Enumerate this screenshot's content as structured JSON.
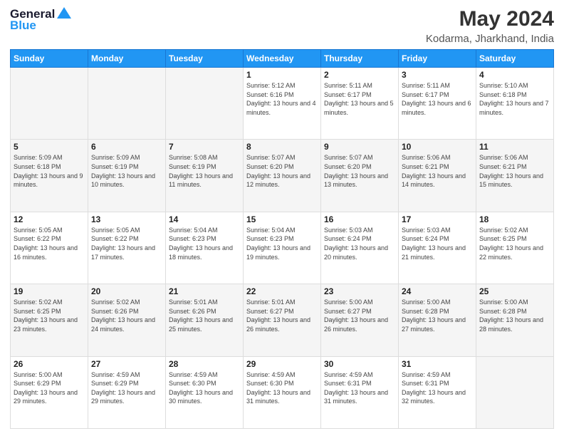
{
  "header": {
    "logo_general": "General",
    "logo_blue": "Blue",
    "title": "May 2024",
    "subtitle": "Kodarma, Jharkhand, India"
  },
  "weekdays": [
    "Sunday",
    "Monday",
    "Tuesday",
    "Wednesday",
    "Thursday",
    "Friday",
    "Saturday"
  ],
  "weeks": [
    [
      {
        "day": "",
        "sunrise": "",
        "sunset": "",
        "daylight": ""
      },
      {
        "day": "",
        "sunrise": "",
        "sunset": "",
        "daylight": ""
      },
      {
        "day": "",
        "sunrise": "",
        "sunset": "",
        "daylight": ""
      },
      {
        "day": "1",
        "sunrise": "Sunrise: 5:12 AM",
        "sunset": "Sunset: 6:16 PM",
        "daylight": "Daylight: 13 hours and 4 minutes."
      },
      {
        "day": "2",
        "sunrise": "Sunrise: 5:11 AM",
        "sunset": "Sunset: 6:17 PM",
        "daylight": "Daylight: 13 hours and 5 minutes."
      },
      {
        "day": "3",
        "sunrise": "Sunrise: 5:11 AM",
        "sunset": "Sunset: 6:17 PM",
        "daylight": "Daylight: 13 hours and 6 minutes."
      },
      {
        "day": "4",
        "sunrise": "Sunrise: 5:10 AM",
        "sunset": "Sunset: 6:18 PM",
        "daylight": "Daylight: 13 hours and 7 minutes."
      }
    ],
    [
      {
        "day": "5",
        "sunrise": "Sunrise: 5:09 AM",
        "sunset": "Sunset: 6:18 PM",
        "daylight": "Daylight: 13 hours and 9 minutes."
      },
      {
        "day": "6",
        "sunrise": "Sunrise: 5:09 AM",
        "sunset": "Sunset: 6:19 PM",
        "daylight": "Daylight: 13 hours and 10 minutes."
      },
      {
        "day": "7",
        "sunrise": "Sunrise: 5:08 AM",
        "sunset": "Sunset: 6:19 PM",
        "daylight": "Daylight: 13 hours and 11 minutes."
      },
      {
        "day": "8",
        "sunrise": "Sunrise: 5:07 AM",
        "sunset": "Sunset: 6:20 PM",
        "daylight": "Daylight: 13 hours and 12 minutes."
      },
      {
        "day": "9",
        "sunrise": "Sunrise: 5:07 AM",
        "sunset": "Sunset: 6:20 PM",
        "daylight": "Daylight: 13 hours and 13 minutes."
      },
      {
        "day": "10",
        "sunrise": "Sunrise: 5:06 AM",
        "sunset": "Sunset: 6:21 PM",
        "daylight": "Daylight: 13 hours and 14 minutes."
      },
      {
        "day": "11",
        "sunrise": "Sunrise: 5:06 AM",
        "sunset": "Sunset: 6:21 PM",
        "daylight": "Daylight: 13 hours and 15 minutes."
      }
    ],
    [
      {
        "day": "12",
        "sunrise": "Sunrise: 5:05 AM",
        "sunset": "Sunset: 6:22 PM",
        "daylight": "Daylight: 13 hours and 16 minutes."
      },
      {
        "day": "13",
        "sunrise": "Sunrise: 5:05 AM",
        "sunset": "Sunset: 6:22 PM",
        "daylight": "Daylight: 13 hours and 17 minutes."
      },
      {
        "day": "14",
        "sunrise": "Sunrise: 5:04 AM",
        "sunset": "Sunset: 6:23 PM",
        "daylight": "Daylight: 13 hours and 18 minutes."
      },
      {
        "day": "15",
        "sunrise": "Sunrise: 5:04 AM",
        "sunset": "Sunset: 6:23 PM",
        "daylight": "Daylight: 13 hours and 19 minutes."
      },
      {
        "day": "16",
        "sunrise": "Sunrise: 5:03 AM",
        "sunset": "Sunset: 6:24 PM",
        "daylight": "Daylight: 13 hours and 20 minutes."
      },
      {
        "day": "17",
        "sunrise": "Sunrise: 5:03 AM",
        "sunset": "Sunset: 6:24 PM",
        "daylight": "Daylight: 13 hours and 21 minutes."
      },
      {
        "day": "18",
        "sunrise": "Sunrise: 5:02 AM",
        "sunset": "Sunset: 6:25 PM",
        "daylight": "Daylight: 13 hours and 22 minutes."
      }
    ],
    [
      {
        "day": "19",
        "sunrise": "Sunrise: 5:02 AM",
        "sunset": "Sunset: 6:25 PM",
        "daylight": "Daylight: 13 hours and 23 minutes."
      },
      {
        "day": "20",
        "sunrise": "Sunrise: 5:02 AM",
        "sunset": "Sunset: 6:26 PM",
        "daylight": "Daylight: 13 hours and 24 minutes."
      },
      {
        "day": "21",
        "sunrise": "Sunrise: 5:01 AM",
        "sunset": "Sunset: 6:26 PM",
        "daylight": "Daylight: 13 hours and 25 minutes."
      },
      {
        "day": "22",
        "sunrise": "Sunrise: 5:01 AM",
        "sunset": "Sunset: 6:27 PM",
        "daylight": "Daylight: 13 hours and 26 minutes."
      },
      {
        "day": "23",
        "sunrise": "Sunrise: 5:00 AM",
        "sunset": "Sunset: 6:27 PM",
        "daylight": "Daylight: 13 hours and 26 minutes."
      },
      {
        "day": "24",
        "sunrise": "Sunrise: 5:00 AM",
        "sunset": "Sunset: 6:28 PM",
        "daylight": "Daylight: 13 hours and 27 minutes."
      },
      {
        "day": "25",
        "sunrise": "Sunrise: 5:00 AM",
        "sunset": "Sunset: 6:28 PM",
        "daylight": "Daylight: 13 hours and 28 minutes."
      }
    ],
    [
      {
        "day": "26",
        "sunrise": "Sunrise: 5:00 AM",
        "sunset": "Sunset: 6:29 PM",
        "daylight": "Daylight: 13 hours and 29 minutes."
      },
      {
        "day": "27",
        "sunrise": "Sunrise: 4:59 AM",
        "sunset": "Sunset: 6:29 PM",
        "daylight": "Daylight: 13 hours and 29 minutes."
      },
      {
        "day": "28",
        "sunrise": "Sunrise: 4:59 AM",
        "sunset": "Sunset: 6:30 PM",
        "daylight": "Daylight: 13 hours and 30 minutes."
      },
      {
        "day": "29",
        "sunrise": "Sunrise: 4:59 AM",
        "sunset": "Sunset: 6:30 PM",
        "daylight": "Daylight: 13 hours and 31 minutes."
      },
      {
        "day": "30",
        "sunrise": "Sunrise: 4:59 AM",
        "sunset": "Sunset: 6:31 PM",
        "daylight": "Daylight: 13 hours and 31 minutes."
      },
      {
        "day": "31",
        "sunrise": "Sunrise: 4:59 AM",
        "sunset": "Sunset: 6:31 PM",
        "daylight": "Daylight: 13 hours and 32 minutes."
      },
      {
        "day": "",
        "sunrise": "",
        "sunset": "",
        "daylight": ""
      }
    ]
  ]
}
